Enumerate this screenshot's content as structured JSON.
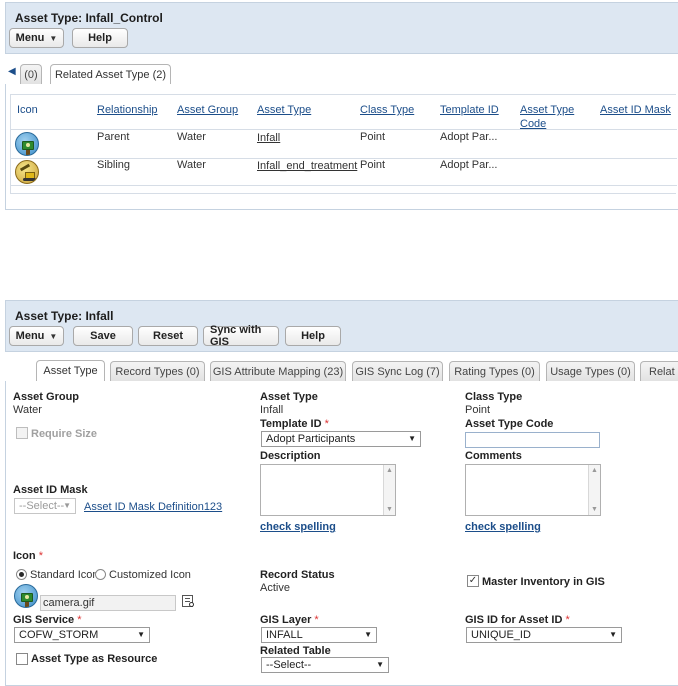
{
  "top_panel": {
    "title": "Asset Type: Infall_Control",
    "menu_label": "Menu",
    "help_label": "Help",
    "tab_count_label": "(0)",
    "tab_related_label": "Related Asset Type (2)",
    "table": {
      "headers": [
        "Icon",
        "Relationship",
        "Asset Group",
        "Asset Type",
        "Class Type",
        "Template ID",
        "Asset Type Code",
        "Asset ID Mask"
      ],
      "rows": [
        {
          "icon": "camera-icon",
          "relationship": "Parent",
          "asset_group": "Water",
          "asset_type": "Infall",
          "class_type": "Point",
          "template_id": "Adopt Par..."
        },
        {
          "icon": "excavator-icon",
          "relationship": "Sibling",
          "asset_group": "Water",
          "asset_type": "Infall_end_treatment",
          "class_type": "Point",
          "template_id": "Adopt Par..."
        }
      ]
    }
  },
  "bottom_panel": {
    "title": "Asset Type: Infall",
    "toolbar": {
      "menu_label": "Menu",
      "save_label": "Save",
      "reset_label": "Reset",
      "sync_label": "Sync with GIS",
      "help_label": "Help"
    },
    "tabs": [
      {
        "label": "Asset Type",
        "active": true
      },
      {
        "label": "Record Types (0)",
        "active": false
      },
      {
        "label": "GIS Attribute Mapping (23)",
        "active": false
      },
      {
        "label": "GIS Sync Log (7)",
        "active": false
      },
      {
        "label": "Rating Types (0)",
        "active": false
      },
      {
        "label": "Usage Types (0)",
        "active": false
      },
      {
        "label": "Relat",
        "active": false
      }
    ],
    "form": {
      "asset_group_label": "Asset Group",
      "asset_group_value": "Water",
      "require_size_label": "Require Size",
      "asset_type_label": "Asset Type",
      "asset_type_value": "Infall",
      "class_type_label": "Class Type",
      "class_type_value": "Point",
      "template_id_label": "Template ID",
      "template_id_value": "Adopt Participants",
      "asset_type_code_label": "Asset Type Code",
      "asset_type_code_value": "",
      "description_label": "Description",
      "comments_label": "Comments",
      "check_spelling_label": "check spelling",
      "asset_id_mask_label": "Asset ID Mask",
      "asset_id_mask_value": "--Select--",
      "asset_id_mask_link": "Asset ID Mask Definition123",
      "icon_label": "Icon",
      "standard_icon_label": "Standard Icon",
      "customized_icon_label": "Customized Icon",
      "icon_file_value": "camera.gif",
      "record_status_label": "Record Status",
      "record_status_value": "Active",
      "master_inventory_label": "Master Inventory in GIS",
      "gis_service_label": "GIS Service",
      "gis_service_value": "COFW_STORM",
      "gis_layer_label": "GIS Layer",
      "gis_layer_value": "INFALL",
      "gis_id_label": "GIS ID for Asset ID",
      "gis_id_value": "UNIQUE_ID",
      "asset_type_as_resource_label": "Asset Type as Resource",
      "related_table_label": "Related Table",
      "related_table_value": "--Select--",
      "required_marker": "*"
    }
  },
  "colors": {
    "header_bg": "#dde7f2",
    "link_blue": "#1c4e8a",
    "required_red": "#d33333"
  }
}
